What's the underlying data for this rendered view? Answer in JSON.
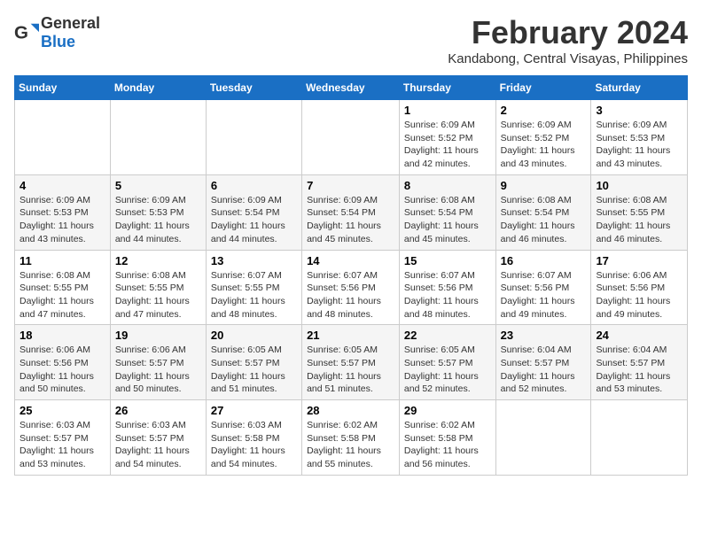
{
  "header": {
    "logo_general": "General",
    "logo_blue": "Blue",
    "month_year": "February 2024",
    "location": "Kandabong, Central Visayas, Philippines"
  },
  "weekdays": [
    "Sunday",
    "Monday",
    "Tuesday",
    "Wednesday",
    "Thursday",
    "Friday",
    "Saturday"
  ],
  "weeks": [
    [
      {
        "day": "",
        "info": ""
      },
      {
        "day": "",
        "info": ""
      },
      {
        "day": "",
        "info": ""
      },
      {
        "day": "",
        "info": ""
      },
      {
        "day": "1",
        "info": "Sunrise: 6:09 AM\nSunset: 5:52 PM\nDaylight: 11 hours and 42 minutes."
      },
      {
        "day": "2",
        "info": "Sunrise: 6:09 AM\nSunset: 5:52 PM\nDaylight: 11 hours and 43 minutes."
      },
      {
        "day": "3",
        "info": "Sunrise: 6:09 AM\nSunset: 5:53 PM\nDaylight: 11 hours and 43 minutes."
      }
    ],
    [
      {
        "day": "4",
        "info": "Sunrise: 6:09 AM\nSunset: 5:53 PM\nDaylight: 11 hours and 43 minutes."
      },
      {
        "day": "5",
        "info": "Sunrise: 6:09 AM\nSunset: 5:53 PM\nDaylight: 11 hours and 44 minutes."
      },
      {
        "day": "6",
        "info": "Sunrise: 6:09 AM\nSunset: 5:54 PM\nDaylight: 11 hours and 44 minutes."
      },
      {
        "day": "7",
        "info": "Sunrise: 6:09 AM\nSunset: 5:54 PM\nDaylight: 11 hours and 45 minutes."
      },
      {
        "day": "8",
        "info": "Sunrise: 6:08 AM\nSunset: 5:54 PM\nDaylight: 11 hours and 45 minutes."
      },
      {
        "day": "9",
        "info": "Sunrise: 6:08 AM\nSunset: 5:54 PM\nDaylight: 11 hours and 46 minutes."
      },
      {
        "day": "10",
        "info": "Sunrise: 6:08 AM\nSunset: 5:55 PM\nDaylight: 11 hours and 46 minutes."
      }
    ],
    [
      {
        "day": "11",
        "info": "Sunrise: 6:08 AM\nSunset: 5:55 PM\nDaylight: 11 hours and 47 minutes."
      },
      {
        "day": "12",
        "info": "Sunrise: 6:08 AM\nSunset: 5:55 PM\nDaylight: 11 hours and 47 minutes."
      },
      {
        "day": "13",
        "info": "Sunrise: 6:07 AM\nSunset: 5:55 PM\nDaylight: 11 hours and 48 minutes."
      },
      {
        "day": "14",
        "info": "Sunrise: 6:07 AM\nSunset: 5:56 PM\nDaylight: 11 hours and 48 minutes."
      },
      {
        "day": "15",
        "info": "Sunrise: 6:07 AM\nSunset: 5:56 PM\nDaylight: 11 hours and 48 minutes."
      },
      {
        "day": "16",
        "info": "Sunrise: 6:07 AM\nSunset: 5:56 PM\nDaylight: 11 hours and 49 minutes."
      },
      {
        "day": "17",
        "info": "Sunrise: 6:06 AM\nSunset: 5:56 PM\nDaylight: 11 hours and 49 minutes."
      }
    ],
    [
      {
        "day": "18",
        "info": "Sunrise: 6:06 AM\nSunset: 5:56 PM\nDaylight: 11 hours and 50 minutes."
      },
      {
        "day": "19",
        "info": "Sunrise: 6:06 AM\nSunset: 5:57 PM\nDaylight: 11 hours and 50 minutes."
      },
      {
        "day": "20",
        "info": "Sunrise: 6:05 AM\nSunset: 5:57 PM\nDaylight: 11 hours and 51 minutes."
      },
      {
        "day": "21",
        "info": "Sunrise: 6:05 AM\nSunset: 5:57 PM\nDaylight: 11 hours and 51 minutes."
      },
      {
        "day": "22",
        "info": "Sunrise: 6:05 AM\nSunset: 5:57 PM\nDaylight: 11 hours and 52 minutes."
      },
      {
        "day": "23",
        "info": "Sunrise: 6:04 AM\nSunset: 5:57 PM\nDaylight: 11 hours and 52 minutes."
      },
      {
        "day": "24",
        "info": "Sunrise: 6:04 AM\nSunset: 5:57 PM\nDaylight: 11 hours and 53 minutes."
      }
    ],
    [
      {
        "day": "25",
        "info": "Sunrise: 6:03 AM\nSunset: 5:57 PM\nDaylight: 11 hours and 53 minutes."
      },
      {
        "day": "26",
        "info": "Sunrise: 6:03 AM\nSunset: 5:57 PM\nDaylight: 11 hours and 54 minutes."
      },
      {
        "day": "27",
        "info": "Sunrise: 6:03 AM\nSunset: 5:58 PM\nDaylight: 11 hours and 54 minutes."
      },
      {
        "day": "28",
        "info": "Sunrise: 6:02 AM\nSunset: 5:58 PM\nDaylight: 11 hours and 55 minutes."
      },
      {
        "day": "29",
        "info": "Sunrise: 6:02 AM\nSunset: 5:58 PM\nDaylight: 11 hours and 56 minutes."
      },
      {
        "day": "",
        "info": ""
      },
      {
        "day": "",
        "info": ""
      }
    ]
  ]
}
